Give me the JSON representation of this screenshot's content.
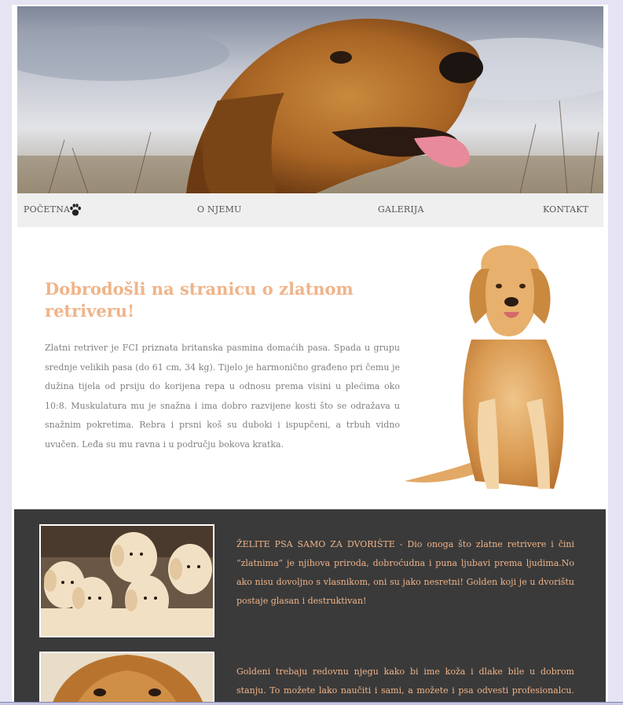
{
  "nav": {
    "home": "POČETNA",
    "about": "O NJEMU",
    "gallery": "GALERIJA",
    "contact": "KONTAKT"
  },
  "intro": {
    "title": "Dobrodošli na stranicu o zlatnom retriveru!",
    "text": "Zlatni retriver je FCI priznata britanska pasmina domaćih pasa. Spada u grupu srednje velikih pasa (do 61 cm, 34 kg). Tijelo je harmonično građeno pri čemu je dužina tijela od prsiju do korijena repa u odnosu prema visini u plećima oko 10:8. Muskulatura mu je snažna i ima dobro razvijene kosti što se odražava u snažnim pokretima. Rebra i prsni koš su duboki i ispupčeni, a trbuh vidno uvučen. Leđa su mu ravna i u području bokova kratka."
  },
  "sections": {
    "first_text": "ŽELITE PSA SAMO ZA DVORIŠTE - Dio onoga što zlatne retrivere i čini “zlatnima” je njihova priroda, dobroćudna i puna ljubavi prema ljudima.No ako nisu dovoljno s vlasnikom, oni su jako nesretni! Golden koji je u dvorištu postaje glasan i destruktivan!",
    "second_text": "Goldeni trebaju redovnu njegu kako bi ime koža i dlake bile u dobrom stanju. To možete lako naučiti i sami, a možete i psa odvesti profesionalcu. Također, vrijeme"
  },
  "colors": {
    "accent": "#f0b489",
    "dark_bg": "#3a3a3a",
    "nav_bg": "#efefef",
    "page_bg": "#e6e4f3"
  },
  "icons": {
    "nav_home": "paw-print-icon"
  }
}
